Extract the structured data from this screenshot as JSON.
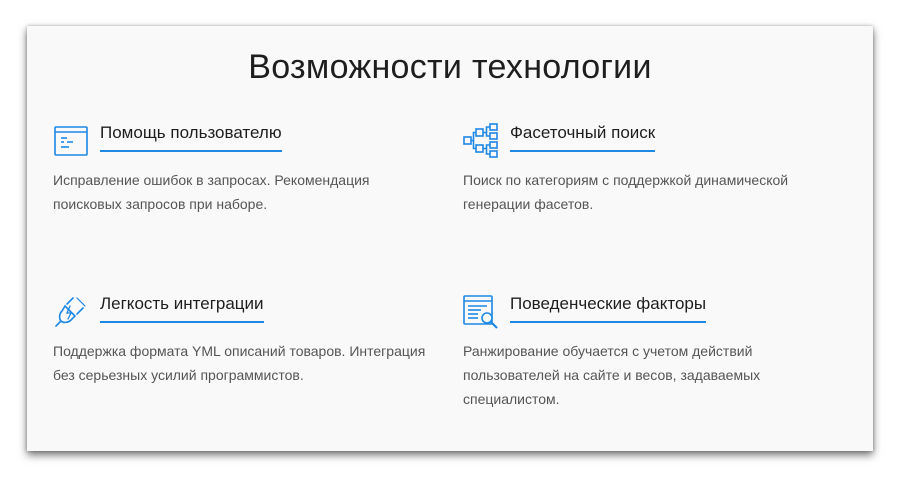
{
  "section": {
    "title": "Возможности технологии"
  },
  "features": [
    {
      "icon": "user-help-window-icon",
      "title": "Помощь пользователю",
      "description": "Исправление ошибок в запросах. Рекомендация поисковых запросов при наборе."
    },
    {
      "icon": "faceted-tree-icon",
      "title": "Фасеточный поиск",
      "description": "Поиск по категориям с поддержкой динамической генерации фасетов."
    },
    {
      "icon": "plug-integration-icon",
      "title": "Легкость интеграции",
      "description": "Поддержка формата YML описаний товаров. Интеграция без серьезных усилий программистов."
    },
    {
      "icon": "document-search-icon",
      "title": "Поведенческие факторы",
      "description": "Ранжирование обучается с учетом действий пользователей на сайте и весов, задаваемых специалистом."
    }
  ],
  "colors": {
    "accent": "#1e88e5",
    "title_text": "#1e1e1e",
    "body_text": "#555555",
    "card_bg": "#f9f9f9"
  }
}
